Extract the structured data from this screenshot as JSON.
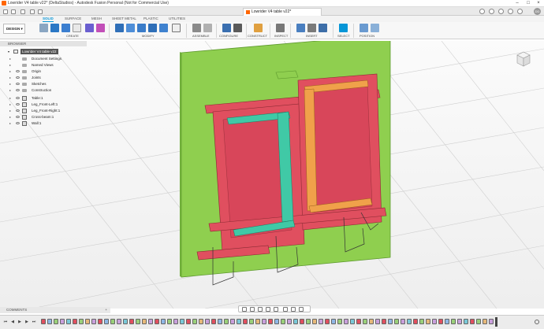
{
  "window": {
    "title": "Lowrider V4 table v22* (DeltaStudios) - Autodesk Fusion Personal (Not for Commercial Use)",
    "doc_tab": "Lowrider V4 table v22*",
    "user_initials": "DD",
    "window_controls": [
      "minimize",
      "maximize",
      "close"
    ]
  },
  "ribbon": {
    "tabs": [
      "SOLID",
      "SURFACE",
      "MESH",
      "SHEET METAL",
      "PLASTIC",
      "UTILITIES"
    ],
    "active_tab": "SOLID",
    "workspace": "DESIGN",
    "groups": [
      "CREATE",
      "MODIFY",
      "ASSEMBLE",
      "CONFIGURE",
      "CONSTRUCT",
      "INSPECT",
      "INSERT",
      "SELECT",
      "POSITION"
    ]
  },
  "browser": {
    "header": "BROWSER",
    "root": "Lowrider V4 table v22",
    "items": [
      {
        "label": "Document Settings",
        "type": "settings"
      },
      {
        "label": "Named Views",
        "type": "folder"
      },
      {
        "label": "Origin",
        "type": "folder"
      },
      {
        "label": "Joints",
        "type": "folder"
      },
      {
        "label": "Sketches",
        "type": "folder"
      },
      {
        "label": "Construction",
        "type": "folder"
      },
      {
        "label": "Table:1",
        "type": "component"
      },
      {
        "label": "Leg_Front-Left:1",
        "type": "component"
      },
      {
        "label": "Leg_Front-Right:1",
        "type": "component"
      },
      {
        "label": "Cross-beam:1",
        "type": "component"
      },
      {
        "label": "Wall:1",
        "type": "component"
      }
    ]
  },
  "comments": {
    "label": "COMMENTS"
  },
  "colors": {
    "accent": "#0696d7",
    "wall": "#8fcf4f",
    "table": "#e04f5f",
    "leg_left": "#40c9a6",
    "leg_right": "#f0a14a",
    "grid": "#c9c9c9"
  },
  "icons": {
    "viewcube": "viewcube-icon",
    "timeline_controls": [
      "first",
      "previous",
      "play",
      "next",
      "last"
    ]
  }
}
